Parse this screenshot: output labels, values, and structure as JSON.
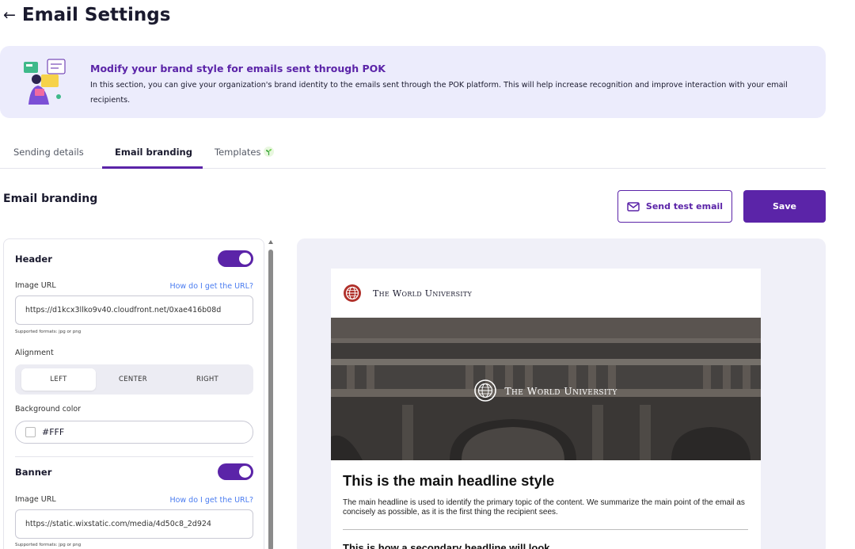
{
  "page": {
    "title": "Email Settings",
    "back_icon": "arrow-left-icon"
  },
  "info_banner": {
    "title": "Modify your brand style for emails sent through POK",
    "text": "In this section, you can give your organization's brand identity to the emails sent through the POK platform. This will help increase recognition and improve interaction with your email recipients."
  },
  "tabs": [
    {
      "label": "Sending details",
      "active": false
    },
    {
      "label": "Email branding",
      "active": true
    },
    {
      "label": "Templates",
      "active": false,
      "badge_icon": "sprout-icon"
    }
  ],
  "section": {
    "title": "Email branding",
    "send_test_label": "Send test email",
    "save_label": "Save"
  },
  "settings": {
    "header": {
      "title": "Header",
      "enabled": true,
      "image_url_label": "Image URL",
      "help_link": "How do I get the URL?",
      "image_url_value": "https://d1kcx3llko9v40.cloudfront.net/0xae416b08d",
      "hint": "Supported formats: jpg or png",
      "alignment_label": "Alignment",
      "alignment_options": [
        "LEFT",
        "CENTER",
        "RIGHT"
      ],
      "alignment_selected": "LEFT",
      "bg_color_label": "Background color",
      "bg_color_value": "#FFF"
    },
    "banner": {
      "title": "Banner",
      "enabled": true,
      "image_url_label": "Image URL",
      "help_link": "How do I get the URL?",
      "image_url_value": "https://static.wixstatic.com/media/4d50c8_2d924",
      "hint": "Supported formats: jpg or png"
    }
  },
  "preview": {
    "header_name": "The World University",
    "banner_name": "The World University",
    "headline": "This is the main headline style",
    "paragraph": "The main headline is used to identify the primary topic of the content. We summarize the main point of the email as concisely as possible, as it is the first thing the recipient sees.",
    "secondary_headline": "This is how a secondary headline will look"
  },
  "colors": {
    "brand_purple": "#5b24a8",
    "banner_bg": "#ececfc",
    "preview_bg": "#f0f0f8",
    "link_blue": "#4a7cf0",
    "crest_red": "#b0302a"
  }
}
